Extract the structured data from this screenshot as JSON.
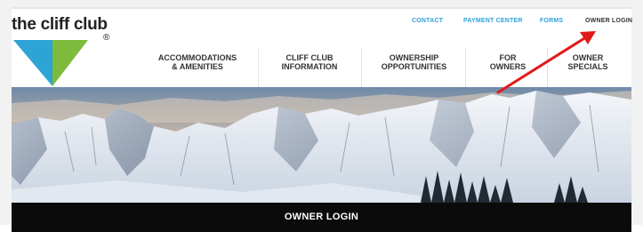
{
  "brand": {
    "name": "the cliff club",
    "registered": "®",
    "colors": {
      "blue": "#2ea3d6",
      "green": "#7dbb3d"
    }
  },
  "utility_nav": {
    "contact": "CONTACT",
    "payment_center": "PAYMENT CENTER",
    "forms": "FORMS",
    "owner_login": "OWNER LOGIN"
  },
  "main_nav": [
    {
      "line1": "ACCOMMODATIONS",
      "line2": "& AMENITIES"
    },
    {
      "line1": "CLIFF CLUB",
      "line2": "INFORMATION"
    },
    {
      "line1": "OWNERSHIP",
      "line2": "OPPORTUNITIES"
    },
    {
      "line1": "FOR",
      "line2": "OWNERS"
    },
    {
      "line1": "OWNER",
      "line2": "SPECIALS"
    }
  ],
  "hero": {
    "subject": "snow-covered-mountain-ridge"
  },
  "login_bar": {
    "label": "OWNER LOGIN"
  },
  "annotation": {
    "color": "#e01a1a",
    "icon": "red-arrow-icon"
  }
}
